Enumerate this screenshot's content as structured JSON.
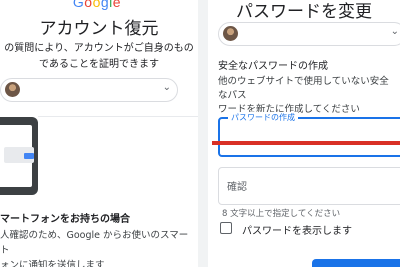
{
  "left_panel": {
    "logo": {
      "text": "Google",
      "letters": [
        "G",
        "o",
        "o",
        "g",
        "l",
        "e"
      ],
      "colors": [
        "#4285F4",
        "#EA4335",
        "#FBBC05",
        "#4285F4",
        "#34A853",
        "#EA4335"
      ]
    },
    "title": "アカウント復元",
    "description_line1": "の質問により、アカウントがご自身のもの",
    "description_line2": "であることを証明できます",
    "account_chip": {
      "caret_icon": "chevron-down-icon"
    },
    "option": {
      "title": "マートフォンをお持ちの場合",
      "description_line1": "人確認のため、Google からお使いのスマート",
      "description_line2": "ォンに通知を送信します"
    }
  },
  "right_panel": {
    "title": "パスワードを変更",
    "account_chip": {
      "caret_icon": "chevron-down-icon"
    },
    "subtitle": "安全なパスワードの作成",
    "instruction_line1": "他のウェブサイトで使用していない安全なパス",
    "instruction_line2": "ワードを新たに作成してください",
    "new_password_label": "パスワードの作成",
    "confirm_label": "確認",
    "hint": "8 文字以上で指定してください",
    "show_password_label": "パスワードを表示します"
  },
  "colors": {
    "accent": "#1a73e8",
    "error": "#d93025"
  }
}
